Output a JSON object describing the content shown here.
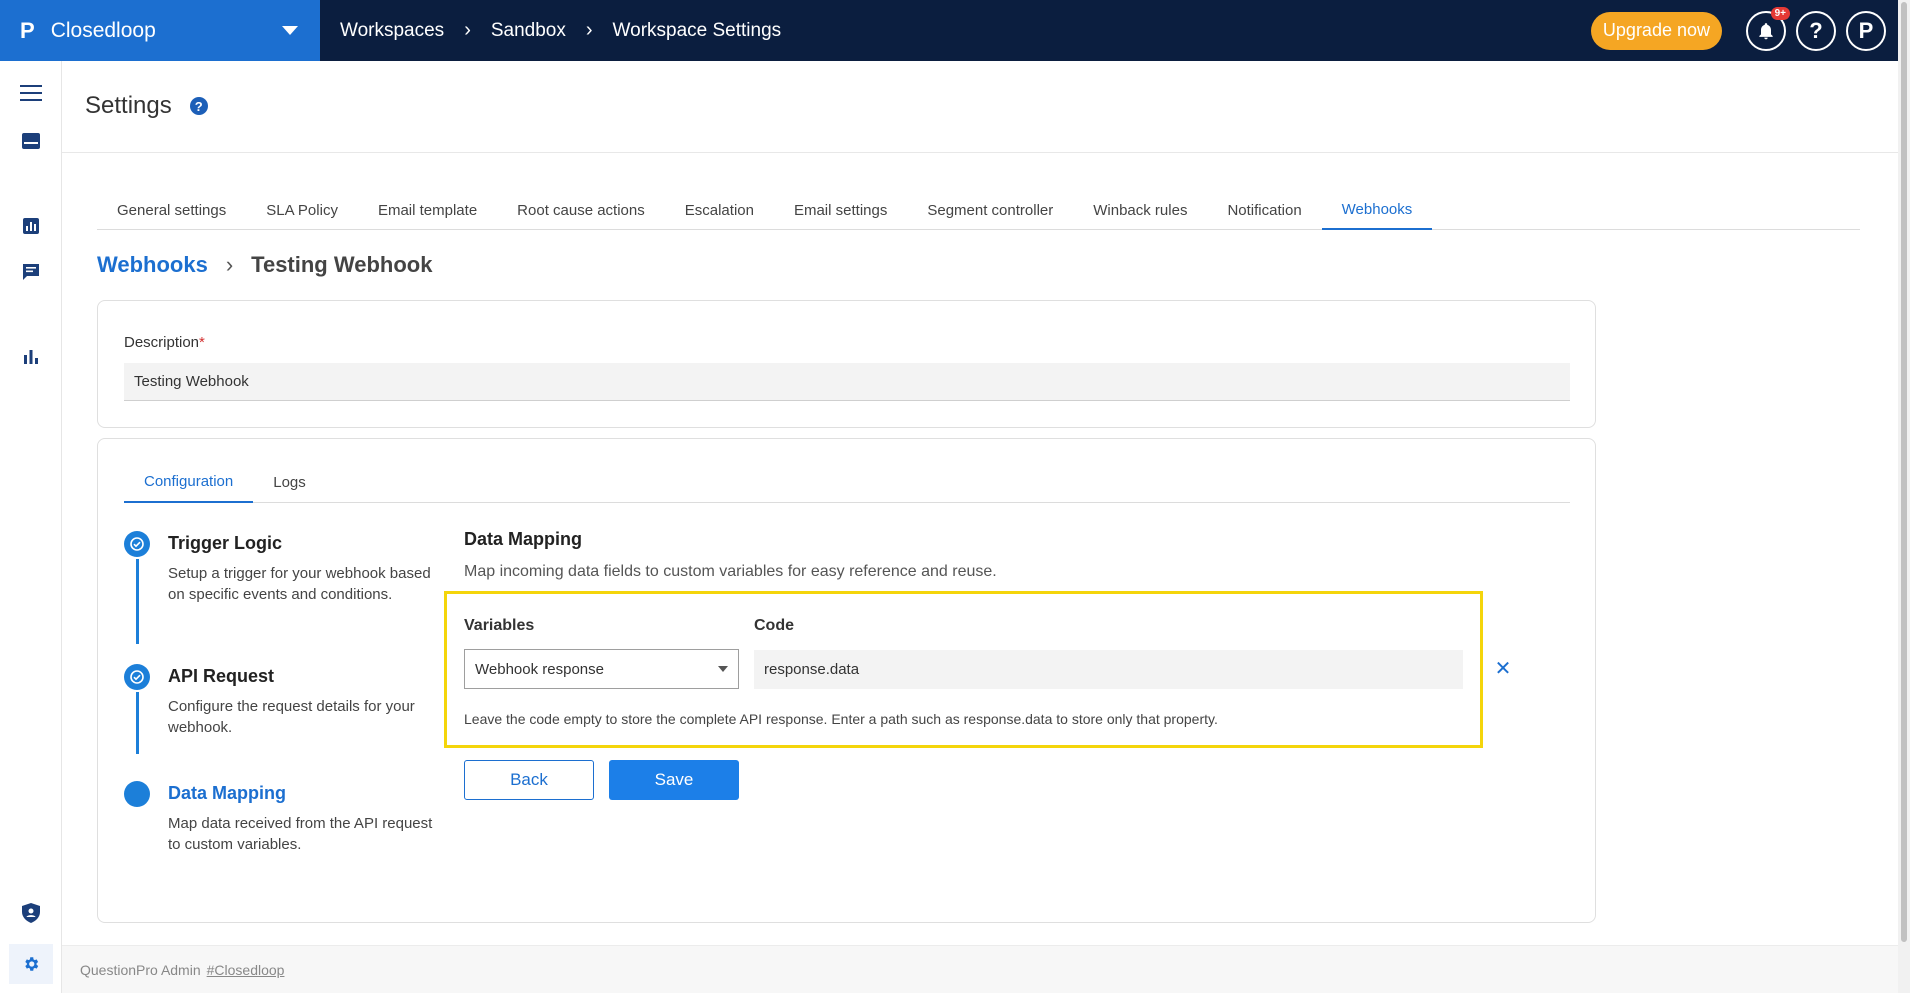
{
  "topbar": {
    "brand": "Closedloop",
    "brand_logo": "P",
    "breadcrumbs": [
      "Workspaces",
      "Sandbox",
      "Workspace Settings"
    ],
    "breadcrumb_sep": "›",
    "upgrade_label": "Upgrade now",
    "notification_badge": "9+",
    "help_label": "?",
    "profile_label": "P"
  },
  "rail": {
    "icons": [
      "menu-icon",
      "inbox-icon",
      "bar-chart-icon",
      "message-icon",
      "analytics-icon",
      "shield-user-icon",
      "settings-icon"
    ]
  },
  "page": {
    "title": "Settings",
    "help": "?"
  },
  "tabs": [
    {
      "label": "General settings"
    },
    {
      "label": "SLA Policy"
    },
    {
      "label": "Email template"
    },
    {
      "label": "Root cause actions"
    },
    {
      "label": "Escalation"
    },
    {
      "label": "Email settings"
    },
    {
      "label": "Segment controller"
    },
    {
      "label": "Winback rules"
    },
    {
      "label": "Notification"
    },
    {
      "label": "Webhooks",
      "active": true
    }
  ],
  "breadcrumb2": {
    "link": "Webhooks",
    "sep": "›",
    "current": "Testing Webhook"
  },
  "description": {
    "label": "Description",
    "required": "*",
    "value": "Testing Webhook"
  },
  "subtabs": [
    {
      "label": "Configuration",
      "active": true
    },
    {
      "label": "Logs"
    }
  ],
  "steps": [
    {
      "title": "Trigger Logic",
      "desc": "Setup a trigger for your webhook based on specific events and conditions.",
      "state": "done"
    },
    {
      "title": "API Request",
      "desc": "Configure the request details for your webhook.",
      "state": "done"
    },
    {
      "title": "Data Mapping",
      "desc": "Map data received from the API request to custom variables.",
      "state": "current"
    }
  ],
  "data_mapping": {
    "title": "Data Mapping",
    "subtitle": "Map incoming data fields to custom variables for easy reference and reuse.",
    "variables_header": "Variables",
    "code_header": "Code",
    "variable_value": "Webhook response",
    "code_value": "response.data",
    "remove_label": "✕",
    "hint": "Leave the code empty to store the complete API response. Enter a path such as response.data to store only that property."
  },
  "actions": {
    "back_label": "Back",
    "save_label": "Save"
  },
  "footer": {
    "text": "QuestionPro Admin",
    "link": "#Closedloop"
  },
  "colors": {
    "primary": "#1c6fd0",
    "topbar": "#0b1e3f",
    "upgrade": "#f5a623",
    "highlight": "#f4d50b"
  }
}
